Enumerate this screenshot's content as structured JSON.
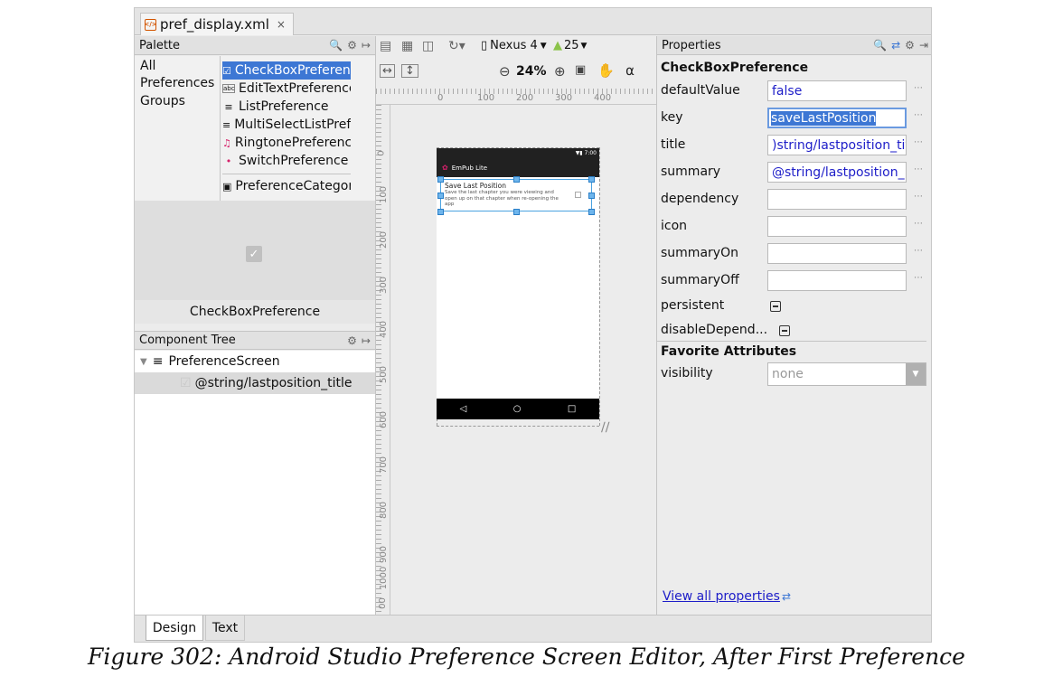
{
  "tab": {
    "filename": "pref_display.xml",
    "close": "×"
  },
  "palette": {
    "title": "Palette",
    "categories": [
      "All",
      "Preferences",
      "Groups"
    ],
    "items": [
      {
        "icon": "checkbox-icon",
        "label": "CheckBoxPreference"
      },
      {
        "icon": "edittext-icon",
        "label": "EditTextPreference"
      },
      {
        "icon": "list-icon",
        "label": "ListPreference"
      },
      {
        "icon": "list-icon",
        "label": "MultiSelectListPreference"
      },
      {
        "icon": "music-note-icon",
        "label": "RingtonePreference"
      },
      {
        "icon": "switch-icon",
        "label": "SwitchPreference"
      },
      {
        "icon": "category-icon",
        "label": "PreferenceCategory"
      }
    ],
    "preview_label": "CheckBoxPreference"
  },
  "toolbar": {
    "device": "Nexus 4",
    "api": "25",
    "zoom": "24%"
  },
  "ruler": {
    "top_ticks": [
      "0",
      "100",
      "200",
      "300",
      "400"
    ],
    "left_ticks": [
      "0",
      "100",
      "200",
      "300",
      "400",
      "500",
      "600",
      "700",
      "800",
      "900",
      "1000",
      "00"
    ]
  },
  "device": {
    "status_time": "7:00",
    "app_title": "EmPub Lite",
    "pref_title": "Save Last Position",
    "pref_summary": "Save the last chapter you were viewing and open up on that chapter when re-opening the app"
  },
  "component_tree": {
    "title": "Component Tree",
    "root": "PreferenceScreen",
    "child": "@string/lastposition_title"
  },
  "properties": {
    "title": "Properties",
    "component": "CheckBoxPreference",
    "rows": [
      {
        "label": "defaultValue",
        "value": "false"
      },
      {
        "label": "key",
        "value": "saveLastPosition"
      },
      {
        "label": "title",
        "value": ")string/lastposition_tit"
      },
      {
        "label": "summary",
        "value": "@string/lastposition_"
      },
      {
        "label": "dependency",
        "value": ""
      },
      {
        "label": "icon",
        "value": ""
      },
      {
        "label": "summaryOn",
        "value": ""
      },
      {
        "label": "summaryOff",
        "value": ""
      }
    ],
    "persistent_label": "persistent",
    "disable_label": "disableDepend...",
    "favorite_title": "Favorite Attributes",
    "visibility_label": "visibility",
    "visibility_value": "none",
    "view_all": "View all properties"
  },
  "bottom_tabs": [
    "Design",
    "Text"
  ],
  "caption": "Figure 302: Android Studio Preference Screen Editor, After First Preference",
  "colors": {
    "selection": "#3d77d4",
    "value_text": "#1d1dc8",
    "toolbar_bar": "#212121"
  }
}
